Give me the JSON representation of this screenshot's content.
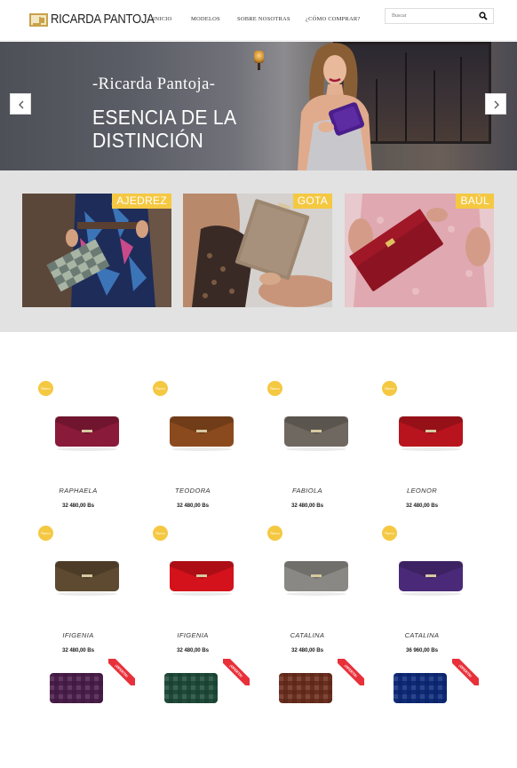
{
  "header": {
    "logo_text": "RICARDA PANTOJA",
    "nav": [
      "INICIO",
      "MODELOS",
      "SOBRE NOSOTRAS",
      "¿CÓMO COMPRAR?"
    ],
    "search_placeholder": "Buscar"
  },
  "hero": {
    "subtitle": "-Ricarda Pantoja-",
    "title": "ESENCIA DE LA\nDISTINCIÓN"
  },
  "categories": [
    {
      "label": "AJEDREZ"
    },
    {
      "label": "GOTA"
    },
    {
      "label": "BAÚL"
    }
  ],
  "badges": {
    "new": "Nuevo",
    "sale": "¡OFERTA!"
  },
  "products": [
    {
      "name": "RAPHAELA",
      "price": "32 480,00 Bs",
      "color": "#8a1a3a"
    },
    {
      "name": "TEODORA",
      "price": "32 480,00 Bs",
      "color": "#8a4a1e"
    },
    {
      "name": "FABIOLA",
      "price": "32 480,00 Bs",
      "color": "#6f6861"
    },
    {
      "name": "LEONOR",
      "price": "32 480,00 Bs",
      "color": "#b8141e"
    },
    {
      "name": "IFIGENIA",
      "price": "32 480,00 Bs",
      "color": "#5d4a30"
    },
    {
      "name": "IFIGENIA",
      "price": "32 480,00 Bs",
      "color": "#d4121c"
    },
    {
      "name": "CATALINA",
      "price": "32 480,00 Bs",
      "color": "#8a8884"
    },
    {
      "name": "CATALINA",
      "price": "36 960,00 Bs",
      "color": "#4a2a78"
    },
    {
      "color": "#4a1e4a"
    },
    {
      "color": "#1f4a3a"
    },
    {
      "color": "#6a2e1e"
    },
    {
      "color": "#0e2a78"
    }
  ]
}
